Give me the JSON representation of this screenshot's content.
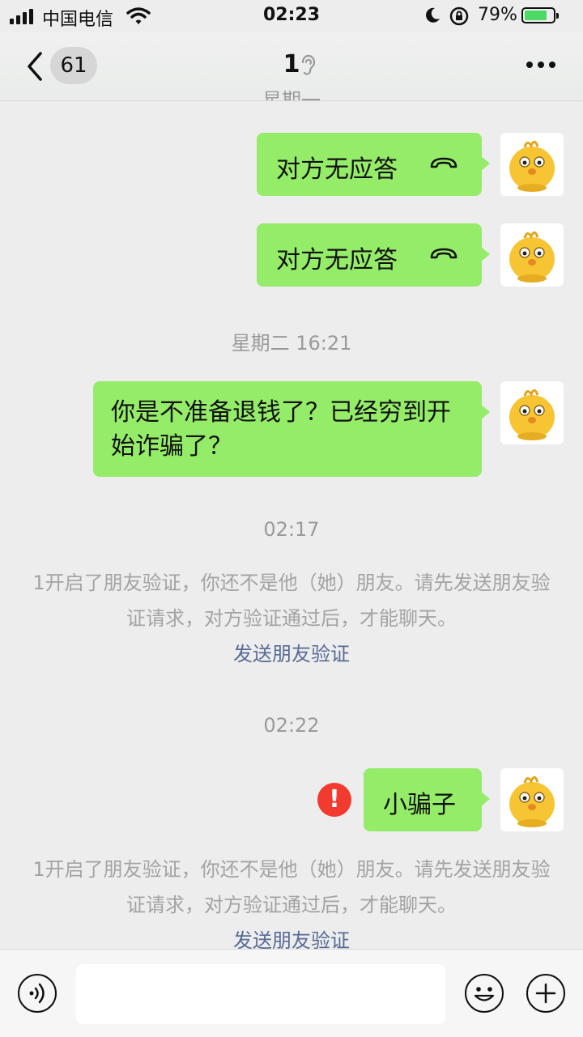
{
  "status": {
    "carrier": "中国电信",
    "time": "02:23",
    "battery": "79%",
    "battery_level": 0.79
  },
  "nav": {
    "unread": "61",
    "title": "1"
  },
  "chat": {
    "partial_ts": "星期一",
    "call1": "对方无应答",
    "call2": "对方无应答",
    "ts1": "星期二 16:21",
    "msg1": "你是不准备退钱了？已经穷到开始诈骗了？",
    "ts2": "02:17",
    "sys1": {
      "text": "1开启了朋友验证，你还不是他（她）朋友。请先发送朋友验证请求，对方验证通过后，才能聊天。",
      "link": "发送朋友验证"
    },
    "ts3": "02:22",
    "msg2": "小骗子",
    "error_mark": "!",
    "sys2": {
      "text": "1开启了朋友验证，你还不是他（她）朋友。请先发送朋友验证请求，对方验证通过后，才能聊天。",
      "link": "发送朋友验证"
    }
  },
  "icons": [
    "signal-icon",
    "wifi-icon",
    "moon-icon",
    "rotation-lock-icon",
    "battery-icon",
    "back-icon",
    "ear-icon",
    "more-icon",
    "hangup-icon",
    "avatar-chick",
    "voice-icon",
    "emoji-icon",
    "plus-icon"
  ],
  "colors": {
    "bubble": "#95ec69",
    "background": "#ededed",
    "link": "#576b95",
    "error": "#f33a2f"
  }
}
